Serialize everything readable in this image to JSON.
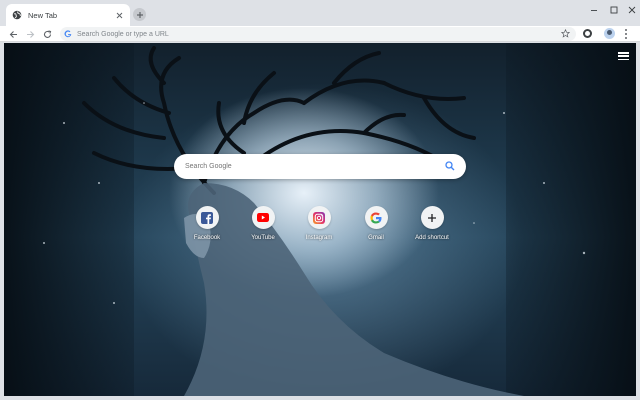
{
  "tab": {
    "title": "New Tab"
  },
  "omnibox": {
    "placeholder": "Search Google or type a URL"
  },
  "ntp": {
    "search_placeholder": "Search Google",
    "shortcuts": [
      {
        "label": "Facebook",
        "icon": "facebook-icon"
      },
      {
        "label": "YouTube",
        "icon": "youtube-icon"
      },
      {
        "label": "Instagram",
        "icon": "instagram-icon"
      },
      {
        "label": "Gmail",
        "icon": "google-icon"
      },
      {
        "label": "Add shortcut",
        "icon": "plus-icon"
      }
    ]
  },
  "colors": {
    "tabstrip": "#dee1e6",
    "toolbar": "#ffffff",
    "omnibox": "#f1f3f4",
    "background_theme": "#26465c"
  }
}
